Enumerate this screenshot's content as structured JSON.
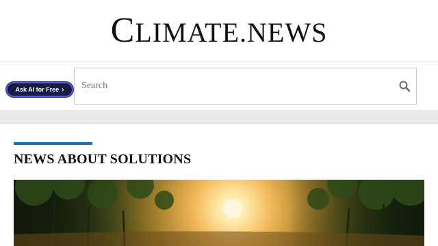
{
  "masthead": {
    "logo_parts": [
      "C",
      "LIMATE",
      ".",
      "NEWS"
    ]
  },
  "toolbar": {
    "ask_ai_label": "Ask AI for Free",
    "search_placeholder": "Search"
  },
  "section": {
    "title": "NEWS ABOUT SOLUTIONS",
    "accent_color": "#1d6fb3"
  },
  "hero": {
    "icon": "forest-sunset-image"
  },
  "colors": {
    "ask_ai_bg": "#181c44",
    "ask_ai_border": "#4b5fd6",
    "band": "#e9e9e9"
  }
}
